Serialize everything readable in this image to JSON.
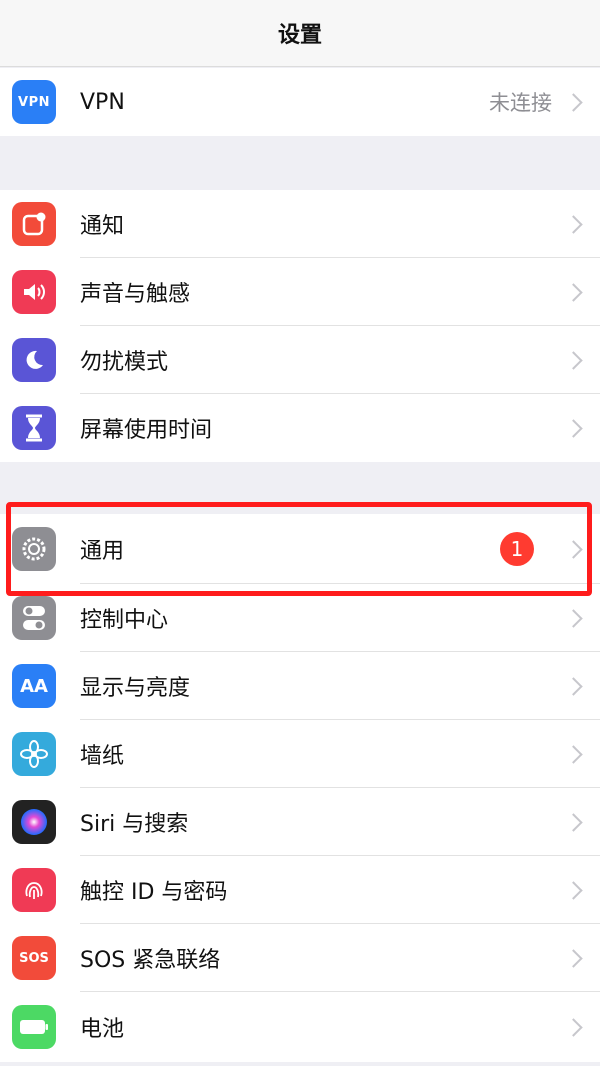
{
  "navbar": {
    "title": "设置"
  },
  "rows": {
    "vpn": {
      "label": "VPN",
      "value": "未连接",
      "icon_text": "VPN",
      "icon": "vpn-icon",
      "color": "#2a7ff6"
    },
    "notifications": {
      "label": "通知",
      "icon": "notifications-icon",
      "color": "#f24b3a"
    },
    "sounds": {
      "label": "声音与触感",
      "icon": "speaker-icon",
      "color": "#f03a55"
    },
    "dnd": {
      "label": "勿扰模式",
      "icon": "moon-icon",
      "color": "#5a55d6"
    },
    "screentime": {
      "label": "屏幕使用时间",
      "icon": "hourglass-icon",
      "color": "#5a55d6"
    },
    "general": {
      "label": "通用",
      "badge": "1",
      "icon": "gear-icon",
      "color": "#8e8e93"
    },
    "control_center": {
      "label": "控制中心",
      "icon": "toggles-icon",
      "color": "#8e8e93"
    },
    "display": {
      "label": "显示与亮度",
      "icon_text": "AA",
      "icon": "display-icon",
      "color": "#2a7ff6"
    },
    "wallpaper": {
      "label": "墙纸",
      "icon": "flower-icon",
      "color": "#34aadc"
    },
    "siri": {
      "label": "Siri 与搜索",
      "icon": "siri-icon",
      "color": "#222222"
    },
    "touchid": {
      "label": "触控 ID 与密码",
      "icon": "fingerprint-icon",
      "color": "#f03a55"
    },
    "sos": {
      "label": "SOS 紧急联络",
      "icon_text": "SOS",
      "icon": "sos-icon",
      "color": "#f24b3a"
    },
    "battery": {
      "label": "电池",
      "icon": "battery-icon",
      "color": "#4cd964"
    }
  },
  "annotation": {
    "color": "#ff1c1c"
  }
}
